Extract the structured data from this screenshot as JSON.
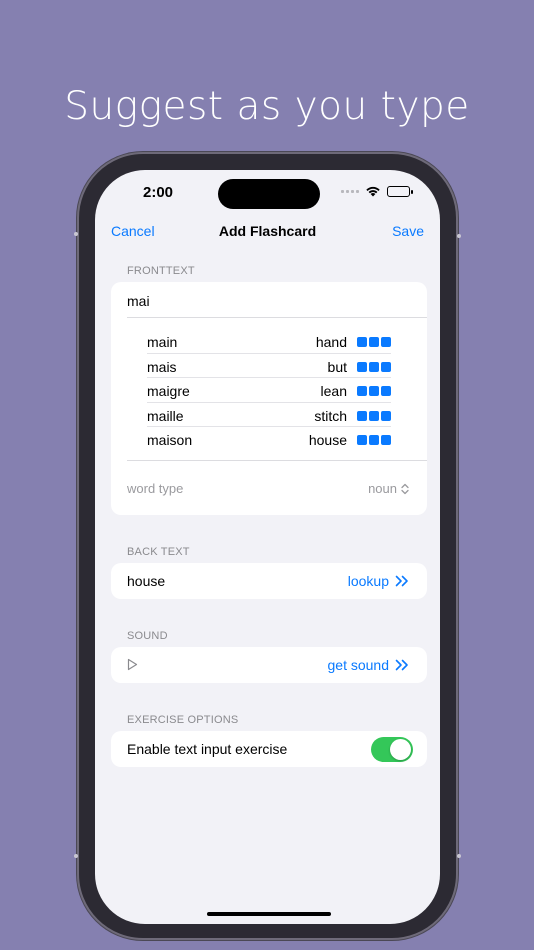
{
  "headline": "Suggest as you type",
  "status": {
    "time": "2:00"
  },
  "nav": {
    "cancel": "Cancel",
    "title": "Add Flashcard",
    "save": "Save"
  },
  "front": {
    "label": "FRONTTEXT",
    "value": "mai",
    "suggestions": [
      {
        "word": "main",
        "translation": "hand"
      },
      {
        "word": "mais",
        "translation": "but"
      },
      {
        "word": "maigre",
        "translation": "lean"
      },
      {
        "word": "maille",
        "translation": "stitch"
      },
      {
        "word": "maison",
        "translation": "house"
      }
    ],
    "word_type_label": "word type",
    "word_type_value": "noun"
  },
  "back": {
    "label": "BACK TEXT",
    "value": "house",
    "link": "lookup"
  },
  "sound": {
    "label": "SOUND",
    "link": "get sound"
  },
  "exercise": {
    "label": "EXERCISE OPTIONS",
    "toggle_label": "Enable text input exercise",
    "enabled": true
  },
  "colors": {
    "accent": "#0a7aff",
    "toggle_on": "#34c759",
    "background": "#8580b0"
  }
}
